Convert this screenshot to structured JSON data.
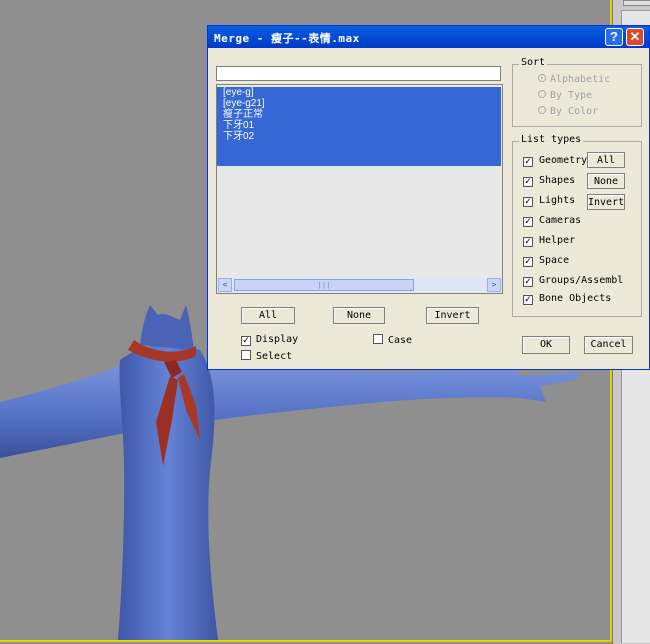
{
  "dialog": {
    "title": "Merge - 瘦子--表情.max",
    "help_glyph": "?",
    "close_glyph": "✕",
    "filter_value": "",
    "list_items": [
      "[eye-g]",
      "[eye-g21]",
      "瘦子正常",
      "下牙01",
      "下牙02"
    ],
    "scroll": {
      "left": "<",
      "right": ">",
      "thumb": "|||"
    },
    "buttons": {
      "all": "All",
      "none": "None",
      "invert": "Invert",
      "ok": "OK",
      "cancel": "Cancel"
    },
    "options": {
      "display": "Display",
      "select": "Select",
      "case": "Case"
    },
    "sort": {
      "label": "Sort",
      "options": [
        "Alphabetic",
        "By Type",
        "By Color"
      ],
      "selected": "Alphabetic"
    },
    "list_types": {
      "label": "List types",
      "items": [
        "Geometry",
        "Shapes",
        "Lights",
        "Cameras",
        "Helper",
        "Space",
        "Groups/Assembl",
        "Bone Objects"
      ],
      "buttons": {
        "all": "All",
        "none": "None",
        "invert": "Invert"
      }
    }
  },
  "colors": {
    "selection": "#3568d4",
    "titlebar": "#0a5fe0",
    "viewport_border": "#e8d000",
    "character": "#5f7ed0",
    "scarf": "#9c3025"
  }
}
